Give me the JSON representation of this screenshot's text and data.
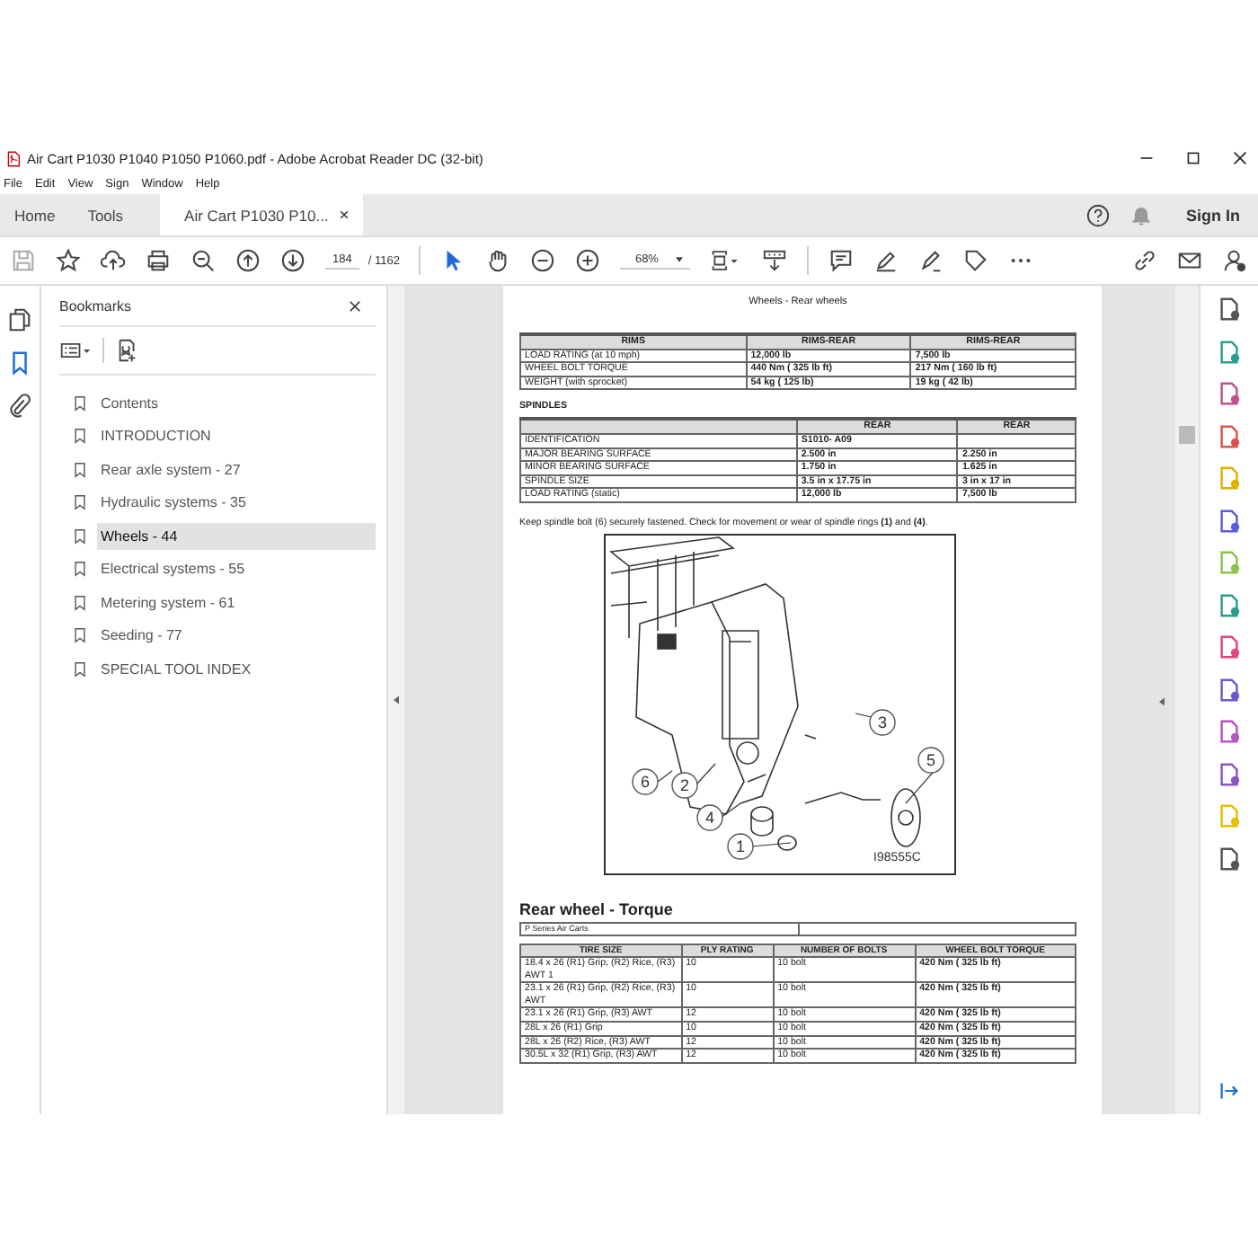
{
  "window": {
    "title": "Air Cart P1030 P1040 P1050 P1060.pdf - Adobe Acrobat Reader DC (32-bit)"
  },
  "menu": [
    "File",
    "Edit",
    "View",
    "Sign",
    "Window",
    "Help"
  ],
  "tabs": [
    {
      "label": "Home",
      "selected": false
    },
    {
      "label": "Tools",
      "selected": false
    },
    {
      "label": "Air Cart P1030 P10...",
      "selected": true
    }
  ],
  "sign_in": "Sign In",
  "toolbar": {
    "page": "184",
    "page_total": "/ 1162",
    "zoom": "68%"
  },
  "bookmarks": {
    "title": "Bookmarks",
    "items": [
      {
        "label": "Contents",
        "selected": false
      },
      {
        "label": "INTRODUCTION",
        "selected": false
      },
      {
        "label": "Rear axle system - 27",
        "selected": false
      },
      {
        "label": "Hydraulic systems - 35",
        "selected": false
      },
      {
        "label": "Wheels - 44",
        "selected": true
      },
      {
        "label": "Electrical systems - 55",
        "selected": false
      },
      {
        "label": "Metering system - 61",
        "selected": false
      },
      {
        "label": "Seeding - 77",
        "selected": false
      },
      {
        "label": "SPECIAL TOOL INDEX",
        "selected": false
      }
    ]
  },
  "document": {
    "header": "Wheels - Rear wheels",
    "rims_table": {
      "columns": [
        "RIMS",
        "RIMS-REAR",
        "RIMS-REAR"
      ],
      "rows": [
        [
          "LOAD RATING (at 10 mph)",
          "12,000 lb",
          "7,500 lb"
        ],
        [
          "WHEEL BOLT TORQUE",
          "440 Nm ( 325 lb ft)",
          "217 Nm ( 160 lb ft)"
        ],
        [
          "WEIGHT (with sprocket)",
          "54 kg ( 125 lb)",
          "19 kg ( 42 lb)"
        ]
      ]
    },
    "spindles_label": "SPINDLES",
    "spindles_table": {
      "columns": [
        "",
        "REAR",
        "REAR"
      ],
      "rows": [
        [
          "IDENTIFICATION",
          "S1010- A09",
          ""
        ],
        [
          "MAJOR BEARING SURFACE",
          "2.500 in",
          "2.250 in"
        ],
        [
          "MINOR BEARING SURFACE",
          "1.750 in",
          "1.625 in"
        ],
        [
          "SPINDLE SIZE",
          "3.5 in x 17.75 in",
          "3 in x 17 in"
        ],
        [
          "LOAD RATING (static)",
          "12,000 lb",
          "7,500 lb"
        ]
      ]
    },
    "note": "Keep spindle bolt (6) securely fastened.  Check for movement or wear of spindle rings **(1)** and **(4)**.",
    "figure": {
      "callouts": [
        "6",
        "2",
        "3",
        "5",
        "4",
        "1"
      ],
      "code": "I98555C"
    },
    "section_title": "Rear wheel - Torque",
    "series_label": "P Series Air Carts",
    "torque_table": {
      "columns": [
        "TIRE SIZE",
        "PLY RATING",
        "NUMBER OF BOLTS",
        "WHEEL BOLT TORQUE"
      ],
      "rows": [
        [
          "18.4 x 26 (R1) Grip, (R2) Rice, (R3) AWT 1",
          "10",
          "10 bolt",
          "420 Nm ( 325 lb ft)"
        ],
        [
          "23.1 x 26 (R1) Grip, (R2) Rice, (R3) AWT",
          "10",
          "10 bolt",
          "420 Nm ( 325 lb ft)"
        ],
        [
          "23.1 x 26 (R1) Grip, (R3) AWT",
          "12",
          "10 bolt",
          "420 Nm ( 325 lb ft)"
        ],
        [
          "28L x 26 (R1) Grip",
          "10",
          "10 bolt",
          "420 Nm ( 325 lb ft)"
        ],
        [
          "28L x 26 (R2) Rice, (R3) AWT",
          "12",
          "10 bolt",
          "420 Nm ( 325 lb ft)"
        ],
        [
          "30.5L x 32 (R1) Grip, (R3) AWT",
          "12",
          "10 bolt",
          "420 Nm ( 325 lb ft)"
        ]
      ]
    }
  }
}
